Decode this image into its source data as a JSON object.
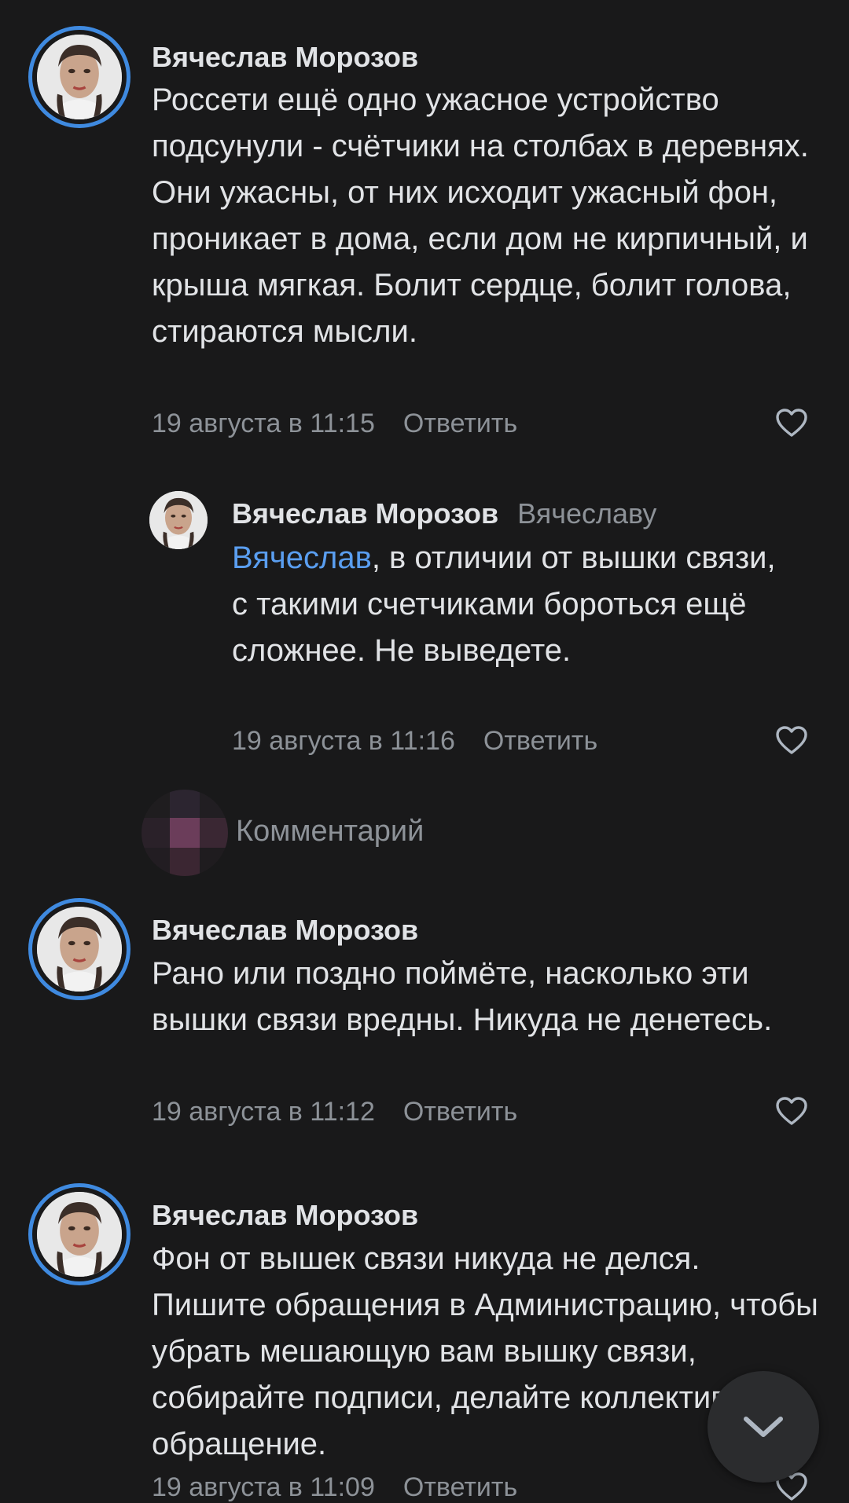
{
  "comments": [
    {
      "author": "Вячеслав Морозов",
      "text": "Россети ещё одно ужасное устройство подсунули - счётчики на столбах в деревнях. Они ужасны, от них исходит ужасный фон, проникает в дома, если дом не кирпичный, и крыша мягкая. Болит сердце, болит голова, стираются мысли.",
      "time": "19 августа в 11:15",
      "reply_label": "Ответить"
    },
    {
      "author": "Вячеслав Морозов",
      "reply_to": "Вячеславу",
      "mention": "Вячеслав",
      "text": ", в отличии от вышки связи, с такими счетчиками бороться ещё сложнее. Не выведете.",
      "time": "19 августа в 11:16",
      "reply_label": "Ответить"
    },
    {
      "author": "Вячеслав Морозов",
      "text": "Рано или поздно поймёте, насколько эти вышки связи вредны. Никуда не денетесь.",
      "time": "19 августа в 11:12",
      "reply_label": "Ответить"
    },
    {
      "author": "Вячеслав Морозов",
      "text": "Фон от вышек связи никуда не делся. Пишите обращения в Администрацию, чтобы убрать мешающую вам вышку связи, собирайте подписи, делайте коллективное обращение.",
      "time": "19 августа в 11:09",
      "reply_label": "Ответить"
    }
  ],
  "reply_input": {
    "placeholder": "Комментарий"
  },
  "icons": {
    "like": "heart-outline-icon",
    "scroll_down": "chevron-down-icon"
  },
  "colors": {
    "background": "#19191a",
    "accent": "#3f8ae0",
    "mention": "#5a9ef0",
    "secondary_text": "#8d9298"
  }
}
